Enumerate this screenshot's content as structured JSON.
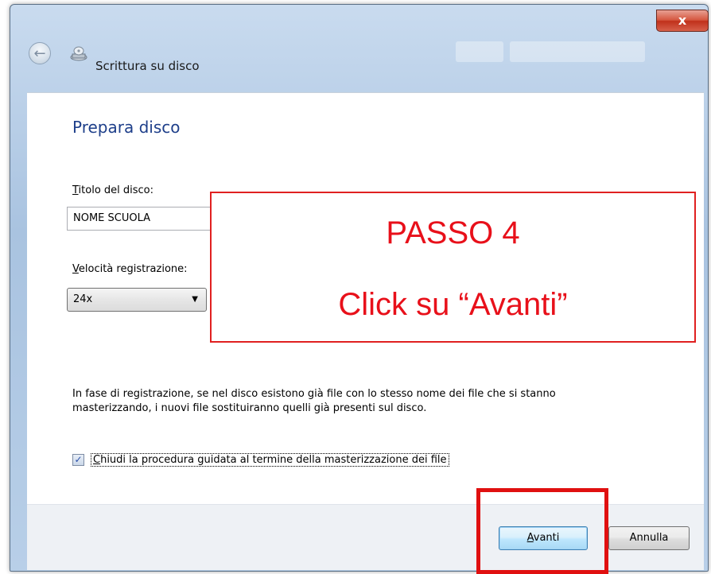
{
  "window": {
    "title": "Scrittura su disco",
    "close_glyph": "x"
  },
  "nav": {
    "back_glyph": "←"
  },
  "page": {
    "heading": "Prepara disco",
    "disc_title_label_key": "T",
    "disc_title_label_rest": "itolo del disco:",
    "disc_title_value": "NOME SCUOLA",
    "speed_label_key": "V",
    "speed_label_rest": "elocità registrazione:",
    "speed_value": "24x",
    "info_text": "In fase di registrazione, se nel disco esistono già file con lo stesso nome dei file che si stanno masterizzando, i nuovi file sostituiranno quelli già presenti sul disco.",
    "checkbox_checked": true,
    "checkbox_glyph": "✓",
    "checkbox_label_key": "C",
    "checkbox_label_rest": "hiudi la procedura guidata al termine della masterizzazione dei file"
  },
  "footer": {
    "next_key": "A",
    "next_rest": "vanti",
    "cancel_label": "Annulla"
  },
  "annotation": {
    "line1": "PASSO 4",
    "line2": "Click su “Avanti”",
    "color": "#e8101a"
  },
  "icons": {
    "back": "back-arrow-icon",
    "burn": "disc-burn-icon",
    "combo": "chevron-down-icon"
  }
}
